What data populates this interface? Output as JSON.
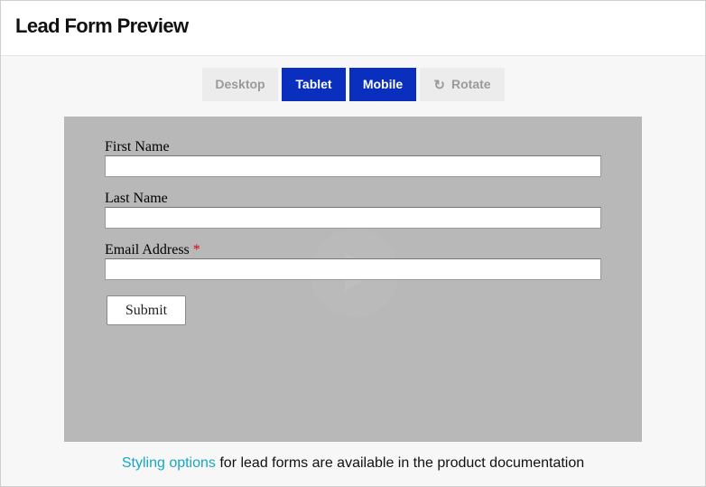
{
  "header": {
    "title": "Lead Form Preview"
  },
  "toolbar": {
    "desktop_label": "Desktop",
    "tablet_label": "Tablet",
    "mobile_label": "Mobile",
    "rotate_label": "Rotate",
    "rotate_icon": "refresh-icon",
    "active": [
      "Tablet",
      "Mobile"
    ]
  },
  "form": {
    "first_name_label": "First Name",
    "first_name_value": "",
    "last_name_label": "Last Name",
    "last_name_value": "",
    "email_label": "Email Address",
    "email_required_marker": "*",
    "email_value": "",
    "submit_label": "Submit"
  },
  "footer": {
    "link_text": "Styling options",
    "text": " for lead forms are available in the product documentation"
  },
  "colors": {
    "active_button": "#0a2fbf",
    "inactive_button": "#ececec",
    "preview_background": "#b8b8b8",
    "link": "#17a6c4",
    "required": "#e00000"
  }
}
